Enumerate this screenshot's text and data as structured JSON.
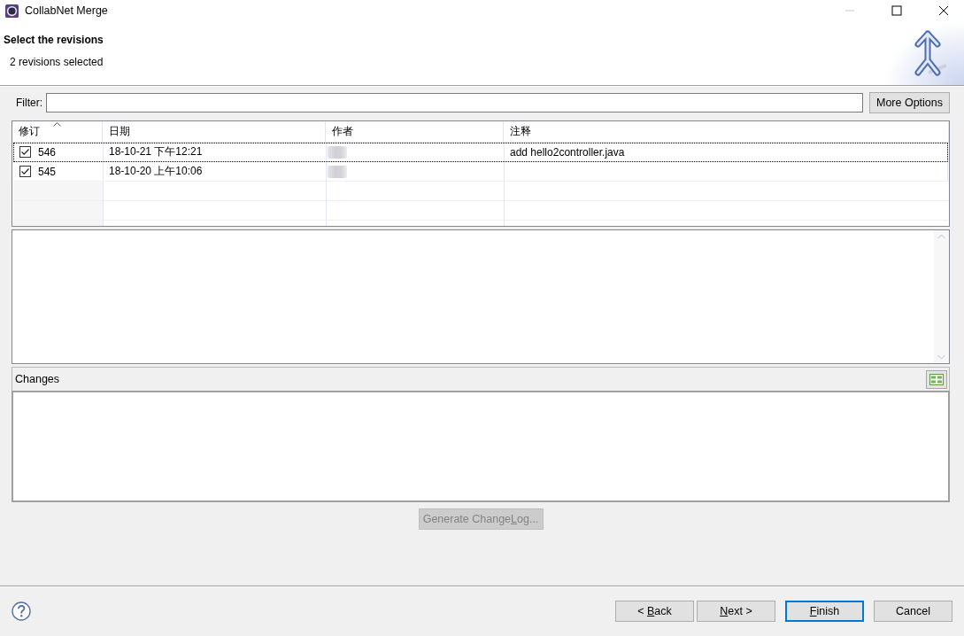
{
  "window": {
    "title": "CollabNet Merge",
    "minimize_disabled": true
  },
  "header": {
    "title": "Select the revisions",
    "message": "2 revisions selected"
  },
  "filter": {
    "label": "Filter:"
  },
  "more_options_button": {
    "label": "More Options"
  },
  "table": {
    "columns": [
      {
        "label": "修订",
        "sorted": true
      },
      {
        "label": "日期",
        "sorted": false
      },
      {
        "label": "作者",
        "sorted": false
      },
      {
        "label": "注释",
        "sorted": false
      }
    ],
    "rows": [
      {
        "revision": "546",
        "date": "18-10-21 下午12:21",
        "comment": "add hello2controller.java",
        "checked": true,
        "focused": true,
        "author_blurred": true
      },
      {
        "revision": "545",
        "date": "18-10-20 上午10:06",
        "checked": true,
        "focused": false,
        "author_blurred": true
      }
    ]
  },
  "changes": {
    "title": "Changes"
  },
  "generate_button": {
    "label": "Generate ChangeLog...",
    "disabled": true
  },
  "buttons": [
    {
      "label": "< Back",
      "default": false
    },
    {
      "label": "Next >",
      "default": false
    },
    {
      "label": "Finish",
      "default": true
    },
    {
      "label": "Cancel",
      "default": false
    }
  ]
}
